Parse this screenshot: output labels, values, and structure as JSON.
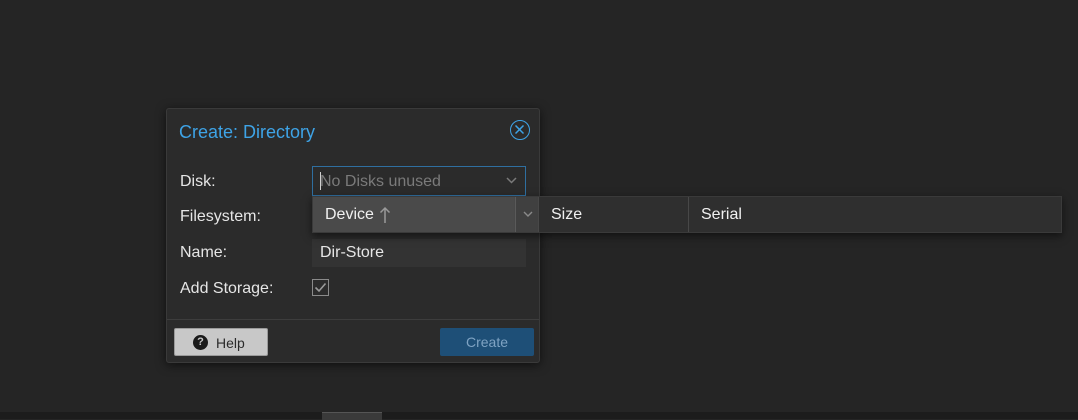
{
  "dialog": {
    "title": "Create: Directory",
    "close_icon": "close-circle-icon",
    "fields": {
      "disk": {
        "label": "Disk:",
        "placeholder": "No Disks unused"
      },
      "filesystem": {
        "label": "Filesystem:"
      },
      "name": {
        "label": "Name:",
        "value": "Dir-Store"
      },
      "add_storage": {
        "label": "Add Storage:",
        "checked": true
      }
    },
    "footer": {
      "help_label": "Help",
      "help_icon": "question-circle-icon",
      "create_label": "Create"
    }
  },
  "disk_picker": {
    "columns": {
      "device": "Device",
      "size": "Size",
      "serial": "Serial"
    },
    "sort": {
      "column": "device",
      "direction": "ascending",
      "icon": "sort-arrow-up-icon"
    }
  },
  "colors": {
    "accent": "#3ea3e6",
    "background": "#252525",
    "dialog_bg": "#2b2b2b",
    "primary_button": "#1e4f77"
  }
}
